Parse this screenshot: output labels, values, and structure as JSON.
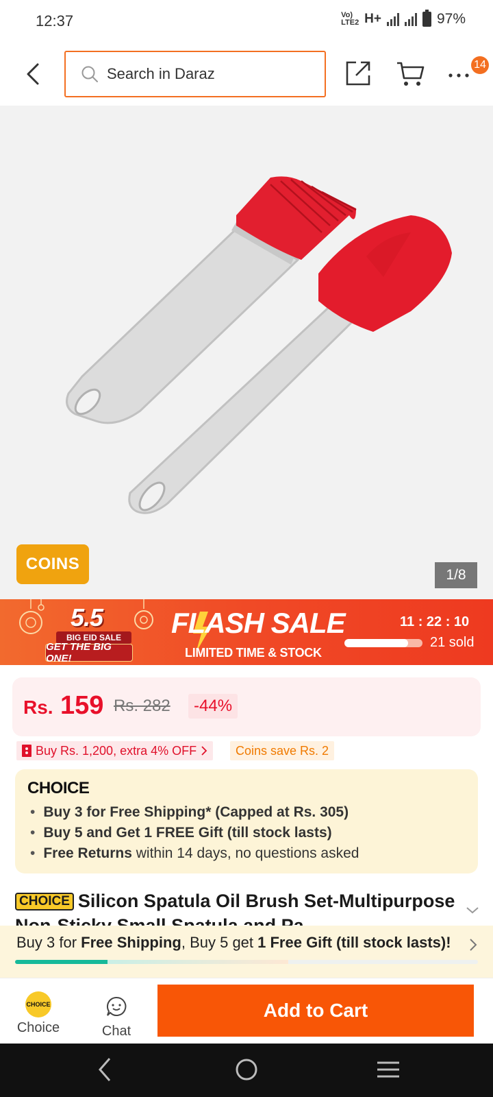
{
  "status_bar": {
    "time": "12:37",
    "network": "H+",
    "lte_label": "Vo) LTE2",
    "battery": "97%"
  },
  "header": {
    "search_placeholder": "Search in Daraz",
    "cart_badge": "14"
  },
  "gallery": {
    "coins_label": "COINS",
    "counter": "1/8"
  },
  "flash_sale": {
    "event_number": "5.5",
    "event_tag": "BIG EID SALE",
    "event_slogan": "GET THE BIG ONE!",
    "title": "FLASH SALE",
    "subtitle": "LIMITED TIME & STOCK",
    "timer": "11 : 22 : 10",
    "sold_text": "21 sold",
    "sold_progress": 0.82
  },
  "price": {
    "currency": "Rs.",
    "current": "159",
    "original": "Rs. 282",
    "discount": "-44%"
  },
  "promos": {
    "voucher": "Buy Rs. 1,200, extra 4% OFF",
    "coins": "Coins save Rs. 2"
  },
  "choice": {
    "logo": "CHOICE",
    "benefit_1": "Buy 3 for  Free Shipping* (Capped at Rs. 305)",
    "benefit_2": "Buy 5 and Get 1 FREE Gift (till stock lasts)",
    "benefit_3_bold": "Free Returns",
    "benefit_3_rest": " within 14 days, no questions asked"
  },
  "product": {
    "choice_tag": "CHOICE",
    "title": "Silicon Spatula Oil Brush Set-Multipurpose Non-Sticky Small Spatula and Pa"
  },
  "shipping_strip": {
    "p1": "Buy 3 for ",
    "b1": "Free Shipping",
    "p2": ", Buy 5 get ",
    "b2": "1 Free Gift (till stock lasts)!",
    "progress_segment_1": 0.2
  },
  "actions": {
    "choice_badge": "CHOICE",
    "choice_label": "Choice",
    "chat_label": "Chat",
    "add_to_cart": "Add to Cart"
  },
  "colors": {
    "brand_orange": "#f85606",
    "price_red": "#e8102a",
    "choice_yellow": "#f8c928",
    "progress_teal": "#16b99a"
  }
}
